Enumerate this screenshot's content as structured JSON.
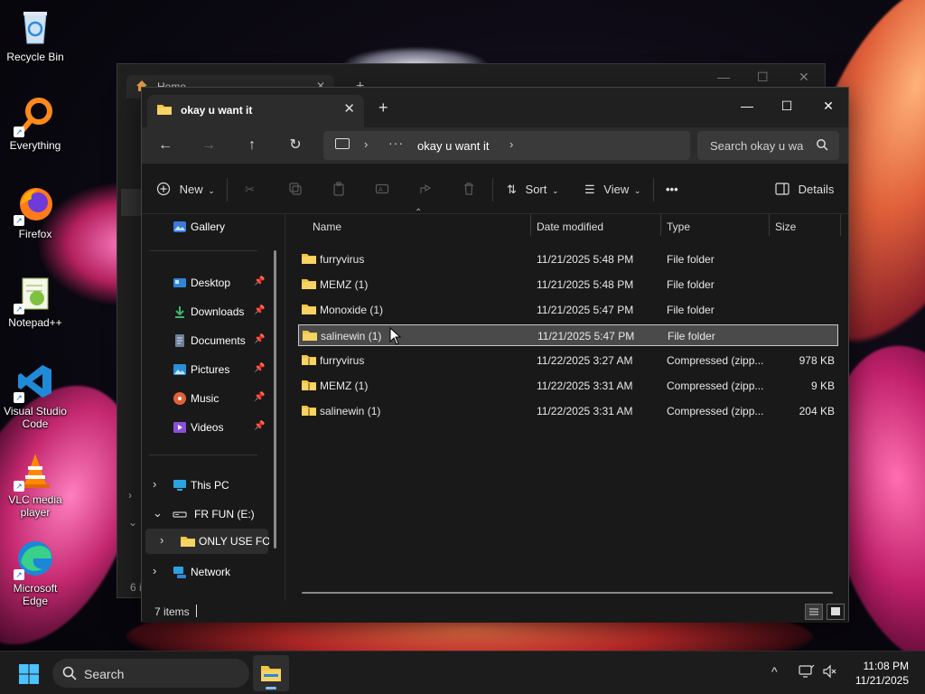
{
  "desktop": {
    "icons": [
      {
        "label": "Recycle Bin"
      },
      {
        "label": "Everything"
      },
      {
        "label": "Firefox"
      },
      {
        "label": "Notepad++"
      },
      {
        "label": "Visual Studio Code"
      },
      {
        "label": "VLC media player"
      },
      {
        "label": "Microsoft Edge"
      }
    ]
  },
  "back_window": {
    "tab_title": "Home",
    "item_count": "6 i"
  },
  "window": {
    "tab_title": "okay u want it",
    "new_tab": "+",
    "minimize": "—",
    "maximize": "☐",
    "close": "✕",
    "nav": {
      "back": "←",
      "forward": "→",
      "up": "↑",
      "refresh": "↻"
    },
    "breadcrumb": {
      "overflow": "···",
      "current": "okay u want it",
      "sep": "›"
    },
    "search_placeholder": "Search okay u want it",
    "toolbar": {
      "new_label": "New",
      "sort_label": "Sort",
      "view_label": "View",
      "more_label": "•••",
      "details_label": "Details"
    },
    "nav_pane": {
      "gallery": "Gallery",
      "quick_access": [
        {
          "label": "Desktop"
        },
        {
          "label": "Downloads"
        },
        {
          "label": "Documents"
        },
        {
          "label": "Pictures"
        },
        {
          "label": "Music"
        },
        {
          "label": "Videos"
        }
      ],
      "this_pc": "This PC",
      "drive": "FR FUN (E:)",
      "drive_child": "ONLY USE FOR",
      "network": "Network"
    },
    "columns": {
      "name": "Name",
      "date": "Date modified",
      "type": "Type",
      "size": "Size"
    },
    "files": [
      {
        "name": "furryvirus",
        "date": "11/21/2025 5:48 PM",
        "type": "File folder",
        "size": ""
      },
      {
        "name": "MEMZ (1)",
        "date": "11/21/2025 5:48 PM",
        "type": "File folder",
        "size": ""
      },
      {
        "name": "Monoxide (1)",
        "date": "11/21/2025 5:47 PM",
        "type": "File folder",
        "size": ""
      },
      {
        "name": "salinewin (1)",
        "date": "11/21/2025 5:47 PM",
        "type": "File folder",
        "size": ""
      },
      {
        "name": "furryvirus",
        "date": "11/22/2025 3:27 AM",
        "type": "Compressed (zipp...",
        "size": "978 KB"
      },
      {
        "name": "MEMZ (1)",
        "date": "11/22/2025 3:31 AM",
        "type": "Compressed (zipp...",
        "size": "9 KB"
      },
      {
        "name": "salinewin (1)",
        "date": "11/22/2025 3:31 AM",
        "type": "Compressed (zipp...",
        "size": "204 KB"
      }
    ],
    "selected_row": "salinewin (1)",
    "status": {
      "item_count": "7 items"
    }
  },
  "taskbar": {
    "search_placeholder": "Search",
    "time": "11:08 PM",
    "date": "11/21/2025",
    "tray_chevron": "^"
  },
  "colors": {
    "accent": "#4cc2ff",
    "folder": "#f4c542",
    "window_bg": "#191919",
    "selection_bg": "#4a4a4a"
  }
}
